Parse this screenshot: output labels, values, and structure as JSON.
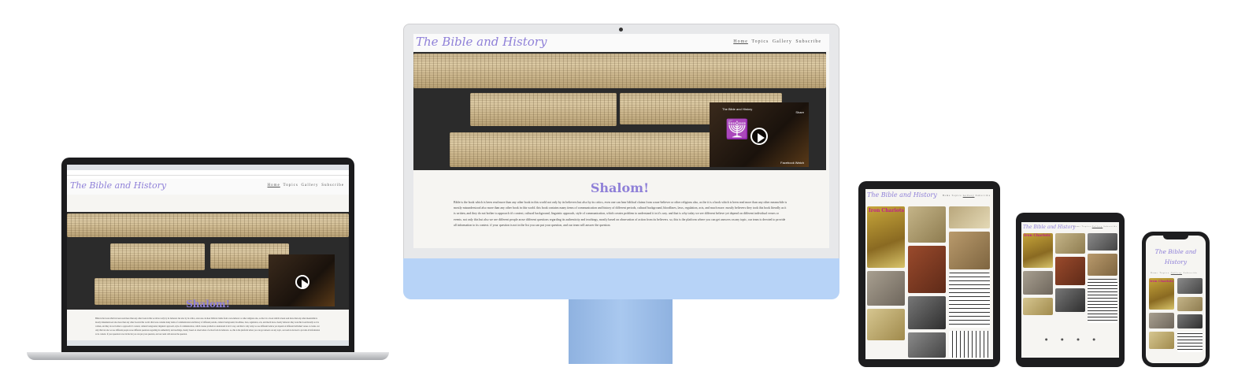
{
  "site": {
    "title": "The Bible and History",
    "nav": [
      "Home",
      "Topics",
      "Gallery",
      "Subscribe"
    ],
    "heading": "Shalom!",
    "paragraph": "Bible is the book which is been read more than any other book in this world not only by its believers but also by its critics, even one can hear biblical claims from a non-believer or other religions also, as the it is a book which is been read more than any other meanwhile is mostly misunderstood also more than any other book in this world. this book contains many items of communication and history of different periods, cultural background, bloodlines, laws, regulation, acts, and much more. mostly believers they took this book literally as it is written, and they do not bother to approach it's context, cultural background, linguistic approach, style of communication, which creates problem to understand it in it's way. and that is why today we see different believe yet depend on different individual verses or events. not only this but also we see different people arose different questions regarding its authenticity and teachings, mostly based on observation of action from its believers. so, this is the platform where you can get answers on any topic, our team is devoted to provide all information to its context. if your question is not in the list you can put your question, and our team will answer the question.",
    "video": {
      "channel": "The Bible and History",
      "share": "Share",
      "watch": "Facebook Watch"
    }
  },
  "gallery": {
    "title": "Iron Chariots"
  },
  "phone_title_lines": [
    "The Bible and",
    "History"
  ],
  "colors": {
    "accent": "#8f80d8",
    "imac_body": "#b7d3f7"
  }
}
